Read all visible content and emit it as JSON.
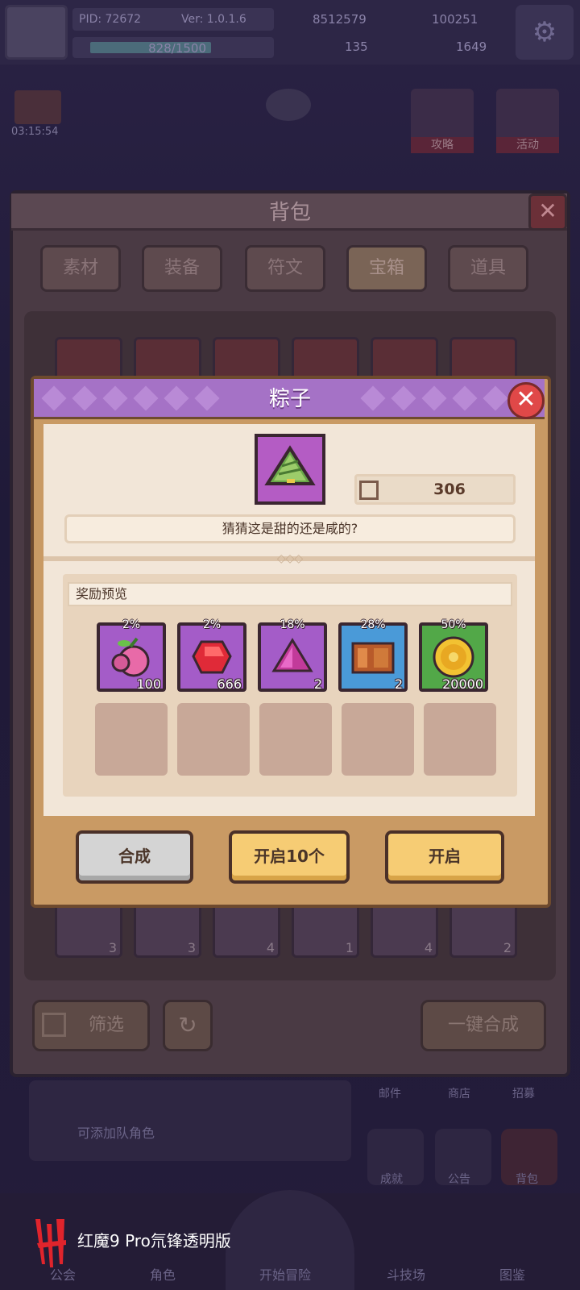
{
  "hud": {
    "pid": "PID: 72672",
    "version": "Ver: 1.0.1.6",
    "exp": "828/1500",
    "currency_1": "8512579",
    "currency_2": "100251",
    "currency_3": "135",
    "currency_4": "1649",
    "timer": "03:15:54",
    "side_buttons": [
      "攻略",
      "活动"
    ]
  },
  "backpack": {
    "title": "背包",
    "tabs": [
      "素材",
      "装备",
      "符文",
      "宝箱",
      "道具"
    ],
    "active_tab": "宝箱",
    "bottom_slot_counts": [
      "3",
      "3",
      "4",
      "1",
      "4",
      "2"
    ],
    "filter_label": "筛选",
    "combine_all_label": "一键合成"
  },
  "item_popup": {
    "title": "粽子",
    "owned_count": "306",
    "description": "猜猜这是甜的还是咸的?",
    "reward_preview_label": "奖励预览",
    "rewards": [
      {
        "chance": "2%",
        "qty": "100",
        "rarity": "purple",
        "icon": "fruit-icon"
      },
      {
        "chance": "2%",
        "qty": "666",
        "rarity": "purple",
        "icon": "ruby-icon"
      },
      {
        "chance": "18%",
        "qty": "2",
        "rarity": "purple",
        "icon": "pyramid-gem-icon"
      },
      {
        "chance": "28%",
        "qty": "2",
        "rarity": "blue",
        "icon": "book-icon"
      },
      {
        "chance": "50%",
        "qty": "20000",
        "rarity": "green",
        "icon": "gold-coin-icon"
      }
    ],
    "buttons": {
      "combine": "合成",
      "open_ten": "开启10个",
      "open": "开启"
    }
  },
  "nav": [
    "公会",
    "角色",
    "开始冒险",
    "斗技场",
    "图鉴"
  ],
  "background_icons": [
    "邮件",
    "商店",
    "招募",
    "成就",
    "公告",
    "背包"
  ],
  "background_text": [
    "可添加队角色"
  ],
  "watermark": "红魔9 Pro氘锋透明版",
  "colors": {
    "popup_header": "#a572c6",
    "popup_border": "#c99a64",
    "button_gold": "#f6cc74",
    "button_gray": "#d4d4d4",
    "close_red": "#e04848"
  }
}
